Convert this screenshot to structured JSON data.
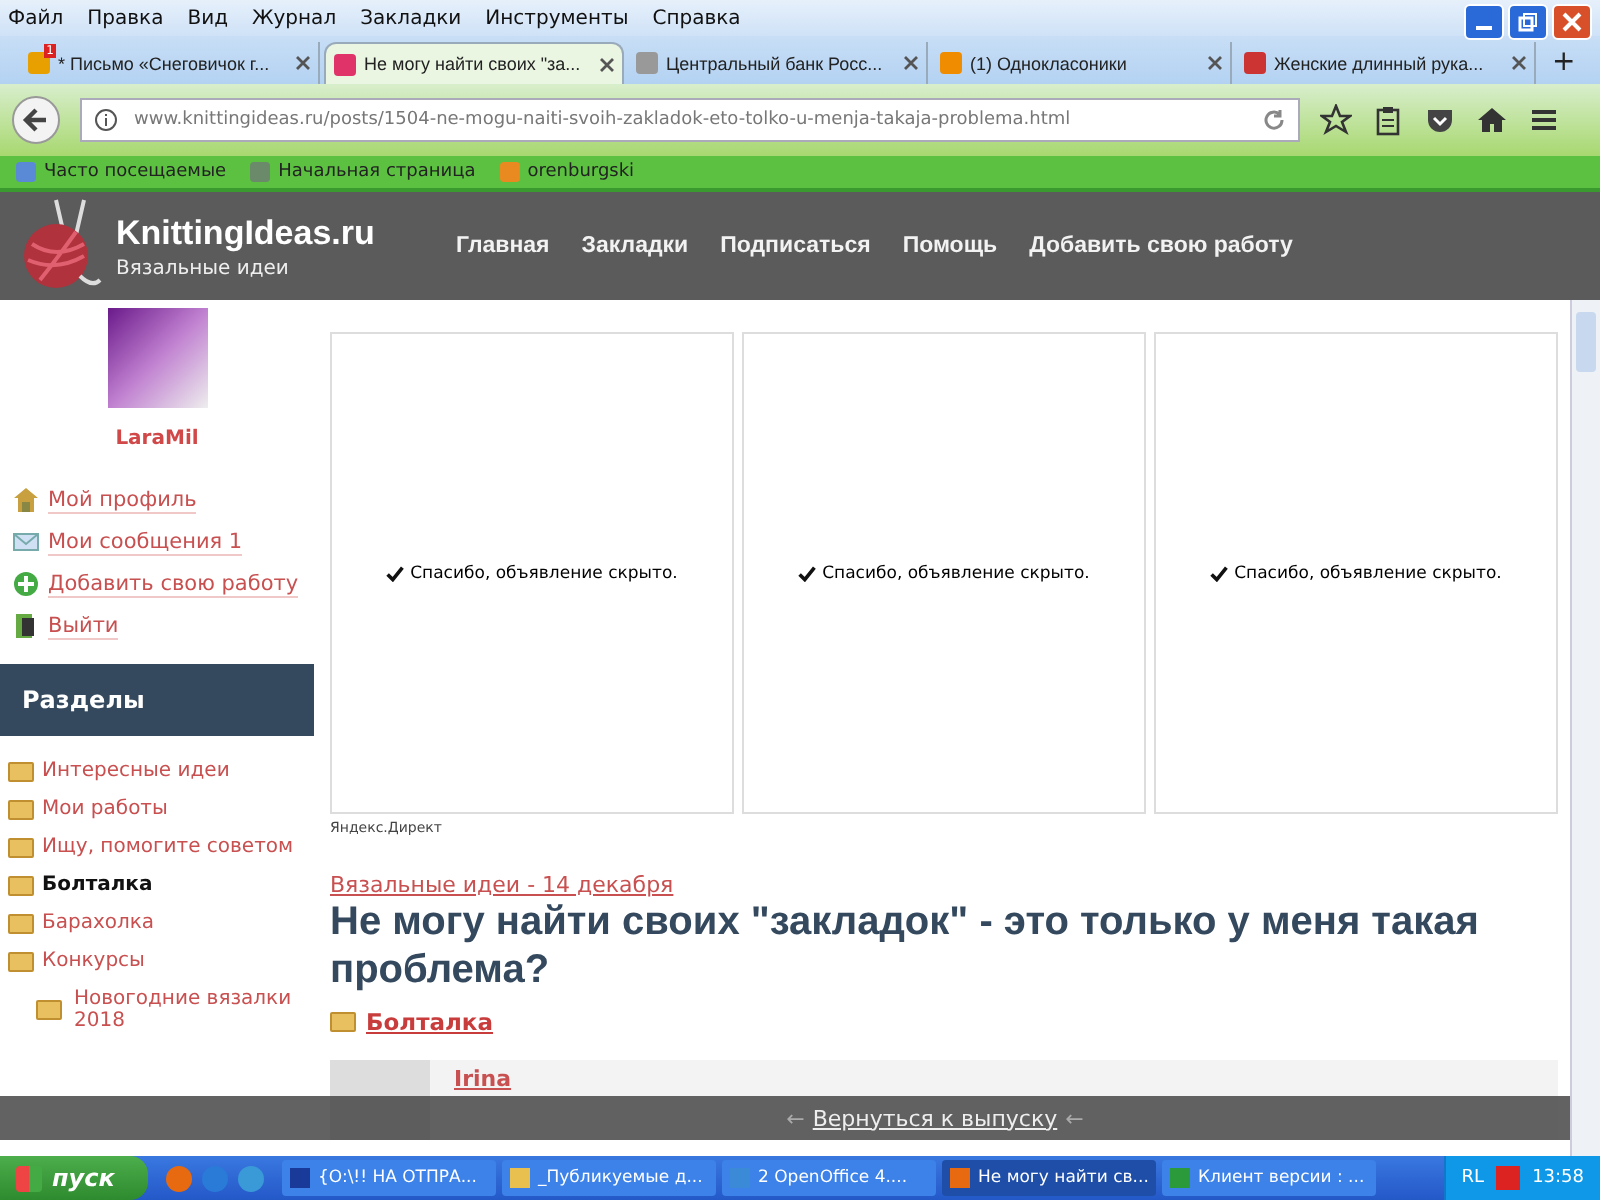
{
  "browser": {
    "menu": [
      "Файл",
      "Правка",
      "Вид",
      "Журнал",
      "Закладки",
      "Инструменты",
      "Справка"
    ],
    "tabs": [
      {
        "title": "* Письмо «Снеговичок г...",
        "selected": false,
        "badge": "1"
      },
      {
        "title": "Не могу найти своих \"за...",
        "selected": true
      },
      {
        "title": "Центральный банк Росс...",
        "selected": false
      },
      {
        "title": "(1) Однокласоники",
        "selected": false
      },
      {
        "title": "Женские длинный рука...",
        "selected": false
      }
    ],
    "new_tab": "+",
    "url": "www.knittingideas.ru/posts/1504-ne-mogu-naiti-svoih-zakladok-eto-tolko-u-menja-takaja-problema.html",
    "bookmarks": [
      "Часто посещаемые",
      "Начальная страница",
      "orenburgski"
    ]
  },
  "site": {
    "logo_title": "KnittingIdeas.ru",
    "logo_subtitle": "Вязальные идеи",
    "nav": [
      "Главная",
      "Закладки",
      "Подписаться",
      "Помощь",
      "Добавить свою работу"
    ]
  },
  "sidebar": {
    "user": "LaraMil",
    "links": [
      {
        "label": "Мой профиль",
        "kind": "home"
      },
      {
        "label": "Мои сообщения 1",
        "kind": "mail"
      },
      {
        "label": "Добавить свою работу",
        "kind": "add"
      },
      {
        "label": "Выйти",
        "kind": "exit"
      }
    ],
    "sections_title": "Разделы",
    "sections": [
      {
        "label": "Интересные идеи",
        "selected": false
      },
      {
        "label": "Мои работы",
        "selected": false
      },
      {
        "label": "Ищу, помогите советом",
        "selected": false
      },
      {
        "label": "Болталка",
        "selected": true
      },
      {
        "label": "Барахолка",
        "selected": false
      },
      {
        "label": "Конкурсы",
        "selected": false,
        "children": [
          {
            "label": "Новогодние вязалки 2018",
            "selected": false
          }
        ]
      }
    ]
  },
  "ads": [
    {
      "text": "Спасибо, объявление скрыто."
    },
    {
      "text": "Спасибо, объявление скрыто."
    },
    {
      "text": "Спасибо, объявление скрыто."
    }
  ],
  "ad_label": "Яндекс.Директ",
  "post": {
    "category_date": "Вязальные идеи - 14 декабря",
    "title": "Не могу найти своих \"закладок\" - это только у меня такая проблема?",
    "category": "Болталка",
    "comment_author": "Irina"
  },
  "overlay": {
    "arrow": "←",
    "back_link": "Вернуться к выпуску"
  },
  "taskbar": {
    "start": "пуск",
    "tasks": [
      {
        "label": "{O:\\!! НА ОТПРА...",
        "selected": false
      },
      {
        "label": "_Публикуемые д...",
        "selected": false
      },
      {
        "label": "2 OpenOffice 4....",
        "selected": false
      },
      {
        "label": "Не могу найти св...",
        "selected": true
      },
      {
        "label": "Клиент версии : ...",
        "selected": false
      }
    ],
    "lang": "RL",
    "clock": "13:58"
  }
}
